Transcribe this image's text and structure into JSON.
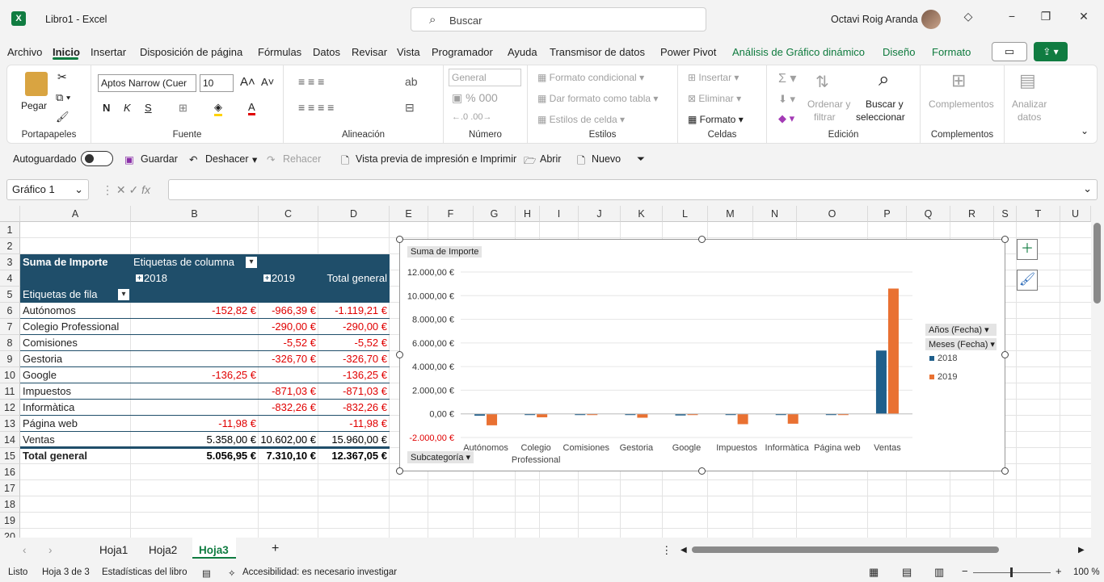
{
  "titlebar": {
    "doc": "Libro1  -  Excel",
    "search_placeholder": "Buscar",
    "user": "Octavi Roig Aranda"
  },
  "menu": [
    "Archivo",
    "Inicio",
    "Insertar",
    "Disposición de página",
    "Fórmulas",
    "Datos",
    "Revisar",
    "Vista",
    "Programador",
    "Ayuda",
    "Transmisor de datos",
    "Power Pivot",
    "Análisis de Gráfico dinámico",
    "Diseño",
    "Formato"
  ],
  "ribbon": {
    "portapapeles": {
      "label": "Portapapeles",
      "pegar": "Pegar"
    },
    "fuente": {
      "label": "Fuente",
      "font": "Aptos Narrow (Cuer",
      "size": "10",
      "bold": "N",
      "italic": "K",
      "underline": "S"
    },
    "alineacion": {
      "label": "Alineación"
    },
    "numero": {
      "label": "Número",
      "format": "General"
    },
    "estilos": {
      "label": "Estilos",
      "cond": "Formato condicional",
      "tabla": "Dar formato como tabla",
      "celda": "Estilos de celda"
    },
    "celdas": {
      "label": "Celdas",
      "insertar": "Insertar",
      "eliminar": "Eliminar",
      "formato": "Formato"
    },
    "edicion": {
      "label": "Edición",
      "ordenar1": "Ordenar y",
      "ordenar2": "filtrar",
      "buscar1": "Buscar y",
      "buscar2": "seleccionar"
    },
    "complementos": {
      "label": "Complementos",
      "btn": "Complementos"
    },
    "analizar": {
      "l1": "Analizar",
      "l2": "datos"
    }
  },
  "qat": {
    "autosave": "Autoguardado",
    "guardar": "Guardar",
    "deshacer": "Deshacer",
    "rehacer": "Rehacer",
    "vista": "Vista previa de impresión e Imprimir",
    "abrir": "Abrir",
    "nuevo": "Nuevo"
  },
  "namebox": "Gráfico 1",
  "columns": [
    "A",
    "B",
    "C",
    "D",
    "E",
    "F",
    "G",
    "H",
    "I",
    "J",
    "K",
    "L",
    "M",
    "N",
    "O",
    "P",
    "Q",
    "R",
    "S",
    "T",
    "U"
  ],
  "rows": [
    "1",
    "2",
    "3",
    "4",
    "5",
    "6",
    "7",
    "8",
    "9",
    "10",
    "11",
    "12",
    "13",
    "14",
    "15",
    "16",
    "17",
    "18",
    "19",
    "20"
  ],
  "pivot": {
    "corner": "Suma de Importe",
    "col_labels": "Etiquetas de columna",
    "row_labels": "Etiquetas de fila",
    "years": [
      "2018",
      "2019"
    ],
    "total_header": "Total general",
    "rows": [
      {
        "label": "Autónomos",
        "y2018": "-152,82 €",
        "y2019": "-966,39 €",
        "total": "-1.119,21 €"
      },
      {
        "label": "Colegio Professional",
        "y2018": "",
        "y2019": "-290,00 €",
        "total": "-290,00 €"
      },
      {
        "label": "Comisiones",
        "y2018": "",
        "y2019": "-5,52 €",
        "total": "-5,52 €"
      },
      {
        "label": "Gestoria",
        "y2018": "",
        "y2019": "-326,70 €",
        "total": "-326,70 €"
      },
      {
        "label": "Google",
        "y2018": "-136,25 €",
        "y2019": "",
        "total": "-136,25 €"
      },
      {
        "label": "Impuestos",
        "y2018": "",
        "y2019": "-871,03 €",
        "total": "-871,03 €"
      },
      {
        "label": "Informàtica",
        "y2018": "",
        "y2019": "-832,26 €",
        "total": "-832,26 €"
      },
      {
        "label": "Página web",
        "y2018": "-11,98 €",
        "y2019": "",
        "total": "-11,98 €"
      },
      {
        "label": "Ventas",
        "y2018": "5.358,00 €",
        "y2019": "10.602,00 €",
        "total": "15.960,00 €"
      }
    ],
    "grand": {
      "label": "Total general",
      "y2018": "5.056,95 €",
      "y2019": "7.310,10 €",
      "total": "12.367,05 €"
    }
  },
  "chart_data": {
    "type": "bar",
    "title": "Suma de Importe",
    "categories": [
      "Autónomos",
      "Colegio Professional",
      "Comisiones",
      "Gestoria",
      "Google",
      "Impuestos",
      "Informàtica",
      "Página web",
      "Ventas"
    ],
    "series": [
      {
        "name": "2018",
        "color": "#1f5f8b",
        "values": [
          -152.82,
          0,
          0,
          0,
          -136.25,
          0,
          0,
          -11.98,
          5358
        ]
      },
      {
        "name": "2019",
        "color": "#e97132",
        "values": [
          -966.39,
          -290,
          -5.52,
          -326.7,
          0,
          -871.03,
          -832.26,
          0,
          10602
        ]
      }
    ],
    "ylim": [
      -2000,
      12000
    ],
    "yticks": [
      "-2.000,00 €",
      "0,00 €",
      "2.000,00 €",
      "4.000,00 €",
      "6.000,00 €",
      "8.000,00 €",
      "10.000,00 €",
      "12.000,00 €"
    ],
    "field_buttons": {
      "axis": "Subcategoría",
      "legend1": "Años (Fecha)",
      "legend2": "Meses (Fecha)"
    },
    "legend": "right",
    "grid": true
  },
  "sheets": [
    "Hoja1",
    "Hoja2",
    "Hoja3"
  ],
  "status": {
    "ready": "Listo",
    "sheet": "Hoja 3 de 3",
    "stats": "Estadísticas del libro",
    "access": "Accesibilidad: es necesario investigar",
    "zoom": "100 %"
  }
}
